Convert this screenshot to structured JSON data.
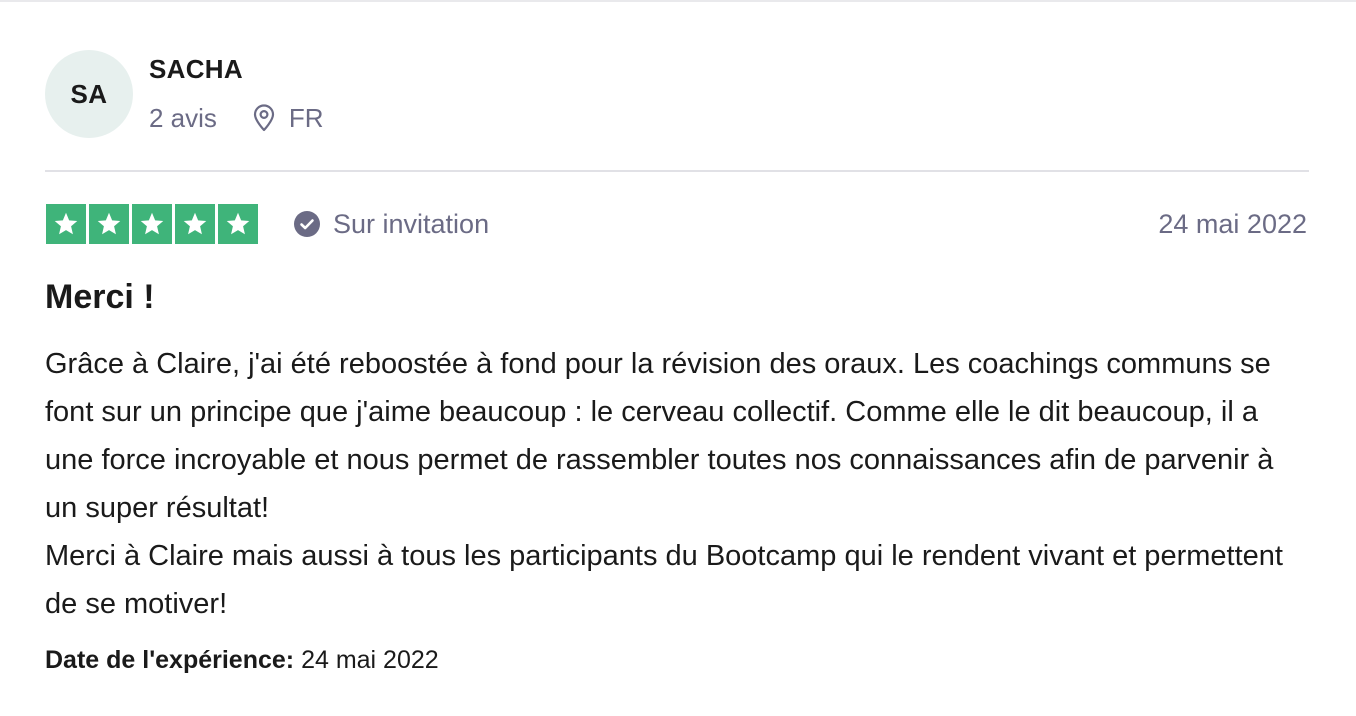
{
  "reviewer": {
    "initials": "SA",
    "name": "SACHA",
    "review_count": "2 avis",
    "country": "FR"
  },
  "review": {
    "rating": 5,
    "rating_max": 5,
    "star_color": "#3fb47a",
    "verification_label": "Sur invitation",
    "date": "24 mai 2022",
    "title": "Merci !",
    "paragraphs": [
      "Grâce à Claire, j'ai été reboostée à fond pour la révision des oraux. Les coachings communs se font sur un principe que j'aime beaucoup : le cerveau collectif. Comme elle le dit beaucoup, il a une force incroyable et nous permet de rassembler toutes nos connaissances afin de parvenir à un super résultat!",
      "Merci à Claire mais aussi à tous les participants du Bootcamp qui le rendent vivant et permettent de se motiver!"
    ],
    "experience_label": "Date de l'expérience:",
    "experience_date": "24 mai 2022"
  },
  "icons": {
    "location": "location-pin-icon",
    "verified": "verified-check-icon",
    "star": "star-icon"
  }
}
